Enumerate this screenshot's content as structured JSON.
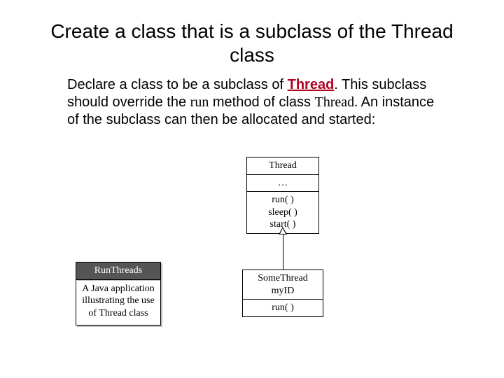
{
  "title": "Create a class that is a subclass of the Thread class",
  "paragraph": {
    "p1": "Declare a class to be a subclass of ",
    "kw": "Thread",
    "p2": ". This subclass should override the ",
    "m1": "run",
    "p3": " method of class ",
    "m2": "Thread.",
    "p4": " An instance of the subclass can then be allocated and started:"
  },
  "uml": {
    "thread": {
      "name": "Thread",
      "attrs": "…",
      "ops": "run( )\nsleep( )\nstart( )"
    },
    "someThread": {
      "name": "SomeThread\nmyID",
      "ops": "run( )"
    },
    "runThreads": {
      "name": "RunThreads",
      "body": "A Java application illustrating the use of Thread class"
    }
  }
}
